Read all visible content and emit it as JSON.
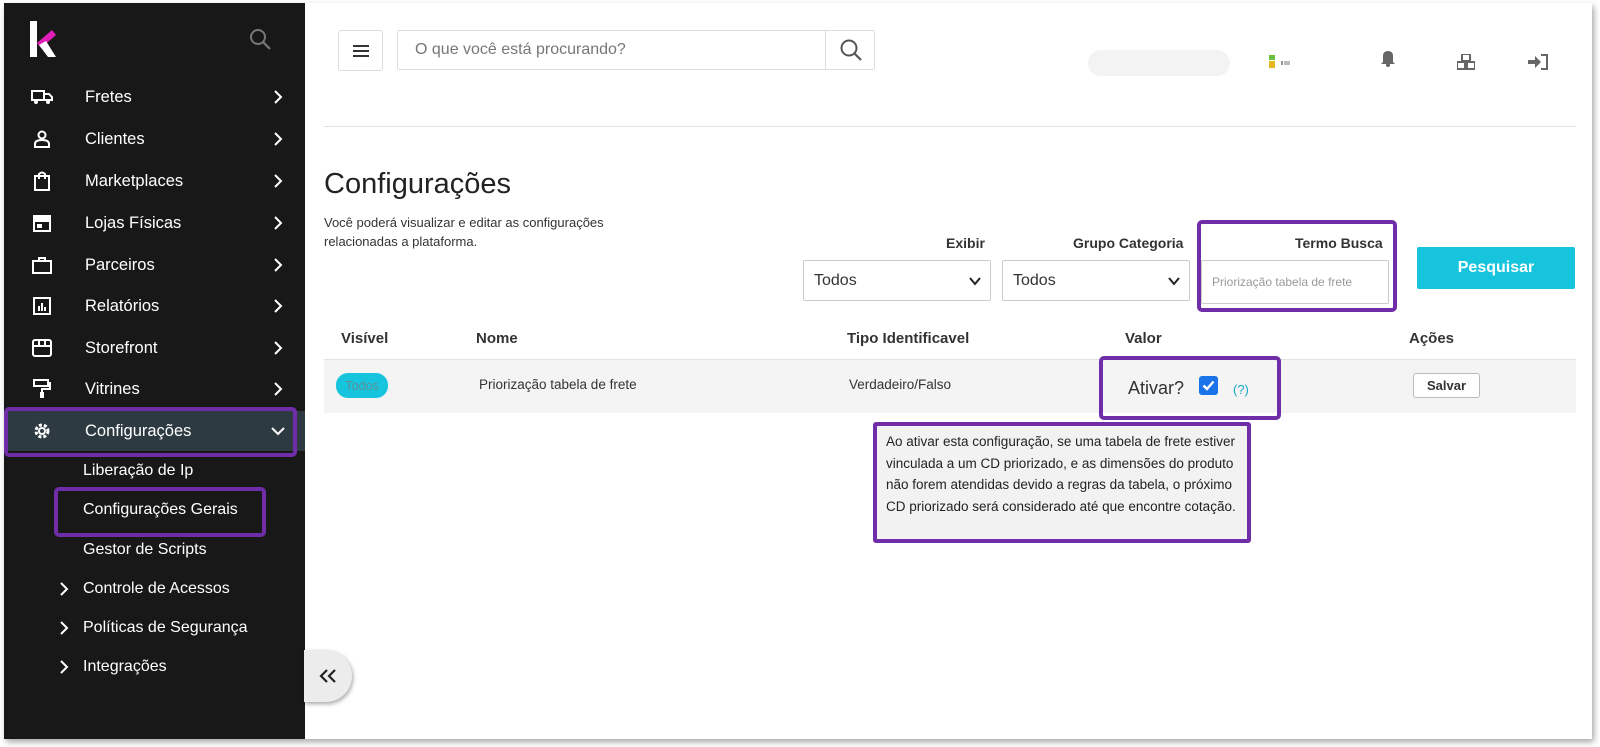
{
  "sidebar": {
    "nav": [
      {
        "label": "Fretes",
        "icon": "truck-icon"
      },
      {
        "label": "Clientes",
        "icon": "user-icon"
      },
      {
        "label": "Marketplaces",
        "icon": "shopping-bag-icon"
      },
      {
        "label": "Lojas Físicas",
        "icon": "store-icon"
      },
      {
        "label": "Parceiros",
        "icon": "briefcase-icon"
      },
      {
        "label": "Relatórios",
        "icon": "report-icon"
      },
      {
        "label": "Storefront",
        "icon": "storefront-icon"
      },
      {
        "label": "Vitrines",
        "icon": "paint-roller-icon"
      },
      {
        "label": "Configurações",
        "icon": "gear-icon"
      }
    ],
    "sub_items": [
      "Liberação de Ip",
      "Configurações Gerais",
      "Gestor de Scripts"
    ],
    "groups": [
      "Controle de Acessos",
      "Políticas de Segurança",
      "Integrações"
    ]
  },
  "header": {
    "search_placeholder": "O que você está procurando?"
  },
  "page": {
    "title": "Configurações",
    "description": "Você poderá visualizar e editar as configurações relacionadas a plataforma."
  },
  "filters": {
    "exibir_label": "Exibir",
    "exibir_value": "Todos",
    "grupo_label": "Grupo Categoria",
    "grupo_value": "Todos",
    "termo_label": "Termo Busca",
    "termo_placeholder": "Priorização tabela de frete",
    "search_button": "Pesquisar"
  },
  "table": {
    "headers": [
      "Visível",
      "Nome",
      "Tipo Identificavel",
      "Valor",
      "Ações"
    ],
    "row": {
      "visivel": "Todos",
      "nome": "Priorização tabela de frete",
      "tipo": "Verdadeiro/Falso",
      "valor_label": "Ativar?",
      "checked": true,
      "help": "(?)",
      "action": "Salvar"
    }
  },
  "tooltip": "Ao ativar esta configuração, se uma tabela de frete estiver vinculada a um CD priorizado, e as dimensões do produto não forem atendidas devido a regras da tabela, o próximo CD priorizado será considerado até que encontre cotação.",
  "colors": {
    "sidebar_bg": "#181818",
    "accent": "#17c4dd",
    "highlight": "#6f2da8",
    "logo_pink": "#e01fb8"
  }
}
